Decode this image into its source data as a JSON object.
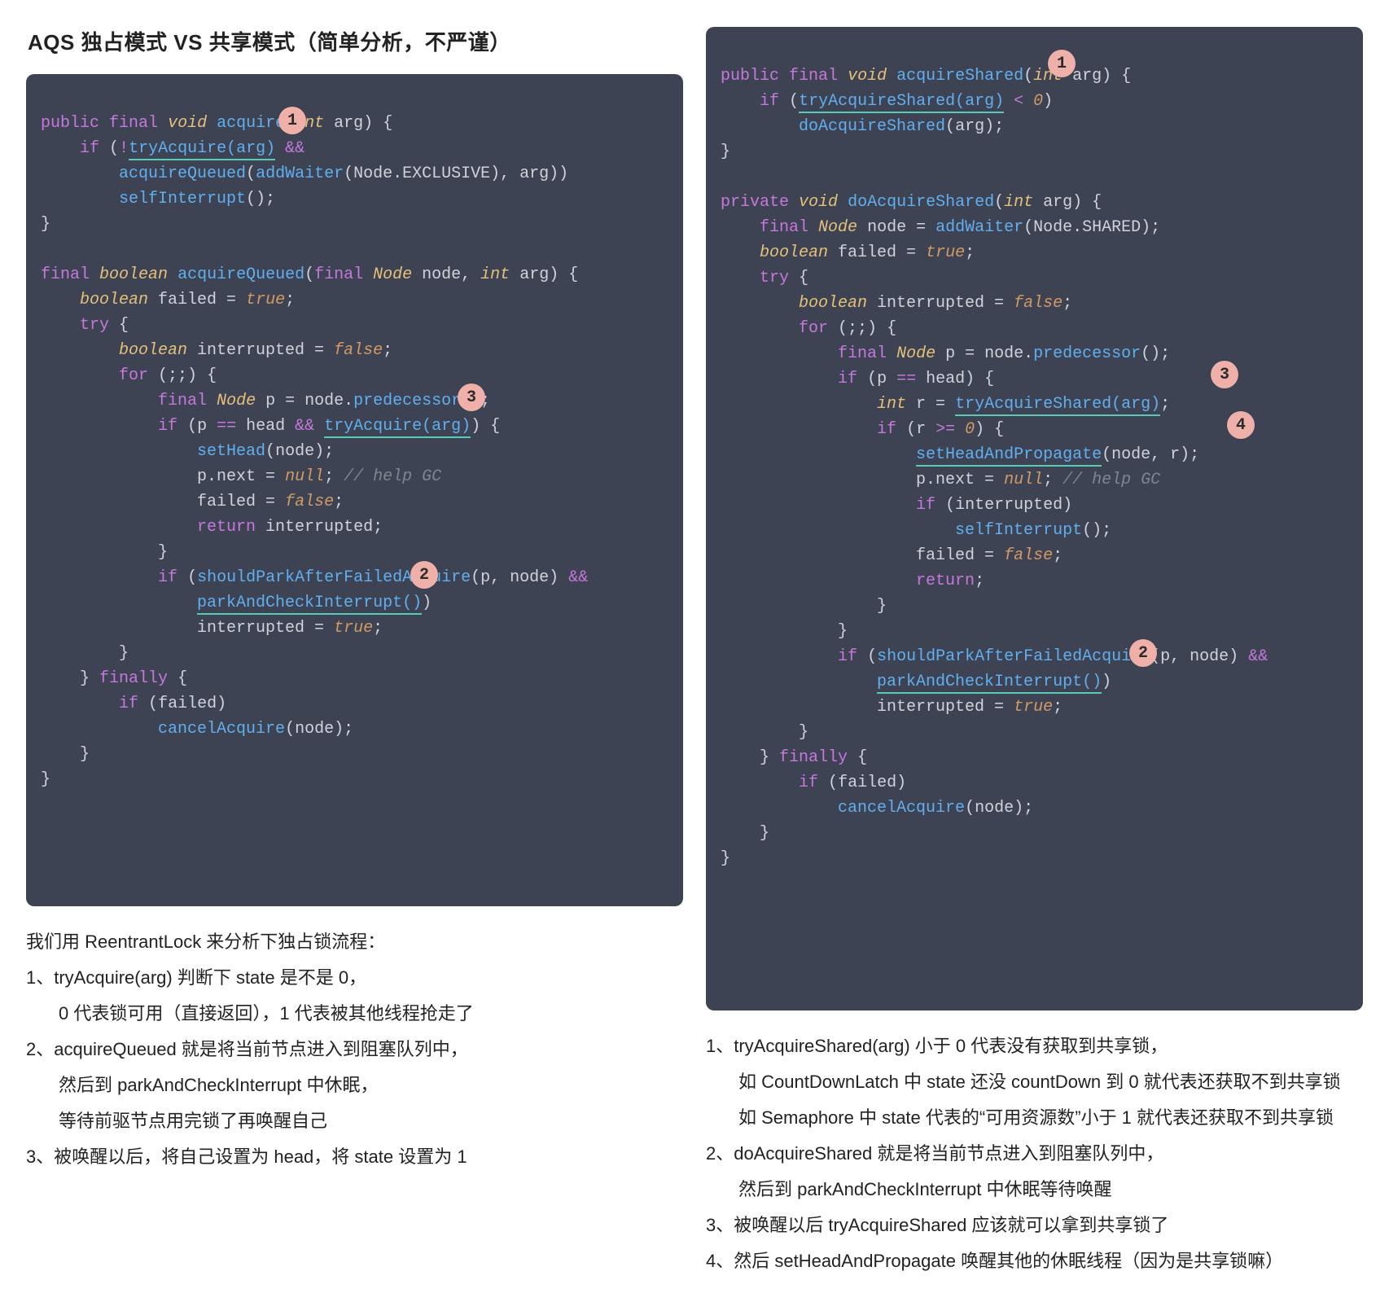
{
  "title": "AQS 独占模式 VS 共享模式（简单分析，不严谨）",
  "left": {
    "code": {
      "l1": "public final void acquire(int arg) {",
      "l2a": "    if (!",
      "l2b": "tryAcquire(arg)",
      "l2c": " &&",
      "l3": "        acquireQueued(addWaiter(Node.EXCLUSIVE), arg))",
      "l4": "        selfInterrupt();",
      "l5": "}",
      "l6": "",
      "l7": "final boolean acquireQueued(final Node node, int arg) {",
      "l8": "    boolean failed = true;",
      "l9": "    try {",
      "l10": "        boolean interrupted = false;",
      "l11": "        for (;;) {",
      "l12": "            final Node p = node.predecessor();",
      "l13a": "            if (p == head && ",
      "l13b": "tryAcquire(arg)",
      "l13c": ") {",
      "l14": "                setHead(node);",
      "l15": "                p.next = null; // help GC",
      "l16": "                failed = false;",
      "l17": "                return interrupted;",
      "l18": "            }",
      "l19": "            if (shouldParkAfterFailedAcquire(p, node) &&",
      "l20a": "                ",
      "l20b": "parkAndCheckInterrupt()",
      "l20c": ")",
      "l21": "                interrupted = true;",
      "l22": "        }",
      "l23": "    } finally {",
      "l24": "        if (failed)",
      "l25": "            cancelAcquire(node);",
      "l26": "    }",
      "l27": "}"
    },
    "badges": {
      "b1": "1",
      "b2": "2",
      "b3": "3"
    },
    "notes": {
      "n0": "我们用 ReentrantLock  来分析下独占锁流程：",
      "n1": "1、tryAcquire(arg) 判断下 state 是不是 0，",
      "n1b": "0 代表锁可用（直接返回），1 代表被其他线程抢走了",
      "n2": "2、acquireQueued 就是将当前节点进入到阻塞队列中，",
      "n2b": "然后到 parkAndCheckInterrupt 中休眠，",
      "n2c": "等待前驱节点用完锁了再唤醒自己",
      "n3": "3、被唤醒以后，将自己设置为 head，将 state 设置为 1"
    }
  },
  "right": {
    "code": {
      "l1": "public final void acquireShared(int arg) {",
      "l2a": "    if (",
      "l2b": "tryAcquireShared(arg)",
      "l2c": " < 0)",
      "l3": "        doAcquireShared(arg);",
      "l4": "}",
      "l5": "",
      "l6": "private void doAcquireShared(int arg) {",
      "l7": "    final Node node = addWaiter(Node.SHARED);",
      "l8": "    boolean failed = true;",
      "l9": "    try {",
      "l10": "        boolean interrupted = false;",
      "l11": "        for (;;) {",
      "l12": "            final Node p = node.predecessor();",
      "l13": "            if (p == head) {",
      "l14a": "                int r = ",
      "l14b": "tryAcquireShared(arg)",
      "l14c": ";",
      "l15": "                if (r >= 0) {",
      "l16a": "                    ",
      "l16b": "setHeadAndPropagate",
      "l16c": "(node, r);",
      "l17": "                    p.next = null; // help GC",
      "l18": "                    if (interrupted)",
      "l19": "                        selfInterrupt();",
      "l20": "                    failed = false;",
      "l21": "                    return;",
      "l22": "                }",
      "l23": "            }",
      "l24": "            if (shouldParkAfterFailedAcquire(p, node) &&",
      "l25a": "                ",
      "l25b": "parkAndCheckInterrupt()",
      "l25c": ")",
      "l26": "                interrupted = true;",
      "l27": "        }",
      "l28": "    } finally {",
      "l29": "        if (failed)",
      "l30": "            cancelAcquire(node);",
      "l31": "    }",
      "l32": "}"
    },
    "badges": {
      "b1": "1",
      "b2": "2",
      "b3": "3",
      "b4": "4"
    },
    "notes": {
      "n1": "1、tryAcquireShared(arg) 小于 0 代表没有获取到共享锁，",
      "n1b": "如 CountDownLatch 中 state 还没 countDown 到 0 就代表还获取不到共享锁",
      "n1c": "如 Semaphore 中 state 代表的“可用资源数”小于 1 就代表还获取不到共享锁",
      "n2": "2、doAcquireShared 就是将当前节点进入到阻塞队列中，",
      "n2b": "然后到 parkAndCheckInterrupt 中休眠等待唤醒",
      "n3": "3、被唤醒以后 tryAcquireShared 应该就可以拿到共享锁了",
      "n4": "4、然后 setHeadAndPropagate 唤醒其他的休眠线程（因为是共享锁嘛）"
    }
  }
}
